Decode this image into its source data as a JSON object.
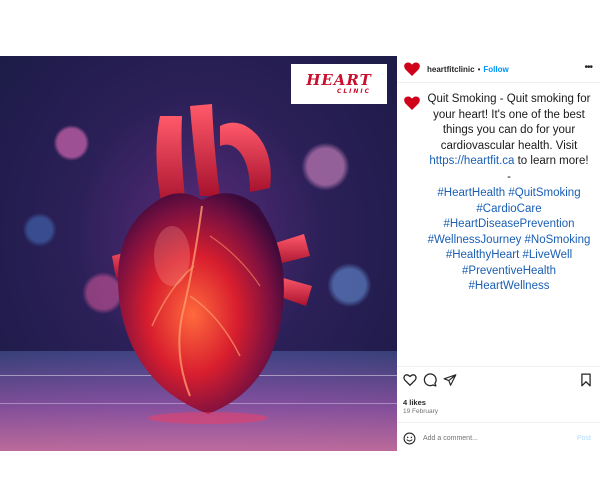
{
  "header": {
    "username": "heartfitclinic",
    "separator": "•",
    "follow_label": "Follow",
    "more_label": "•••"
  },
  "media": {
    "logo_main": "HEART",
    "logo_sub": "CLINIC",
    "brand_color": "#c8102e"
  },
  "caption": {
    "text_before_link": "Quit Smoking - Quit smoking for your heart! It's one of the best things you can do for your cardiovascular health. Visit ",
    "link": "https://heartfit.ca",
    "text_after_link": " to learn more!",
    "dash": "-",
    "hashtags": "#HeartHealth #QuitSmoking #CardioCare #HeartDiseasePrevention #WellnessJourney #NoSmoking #HealthyHeart #LiveWell #PreventiveHealth #HeartWellness"
  },
  "engagement": {
    "likes": "4 likes",
    "date": "19 February"
  },
  "comment": {
    "placeholder": "Add a comment...",
    "post_label": "Post"
  },
  "icons": {
    "avatar": "heart-avatar-icon",
    "like": "heart-outline-icon",
    "comment": "comment-bubble-icon",
    "share": "paper-plane-icon",
    "save": "bookmark-icon",
    "emoji": "smiley-icon"
  },
  "colors": {
    "accent": "#0095f6",
    "hashtag": "#1a5fb4",
    "avatar_red": "#d0021b"
  }
}
